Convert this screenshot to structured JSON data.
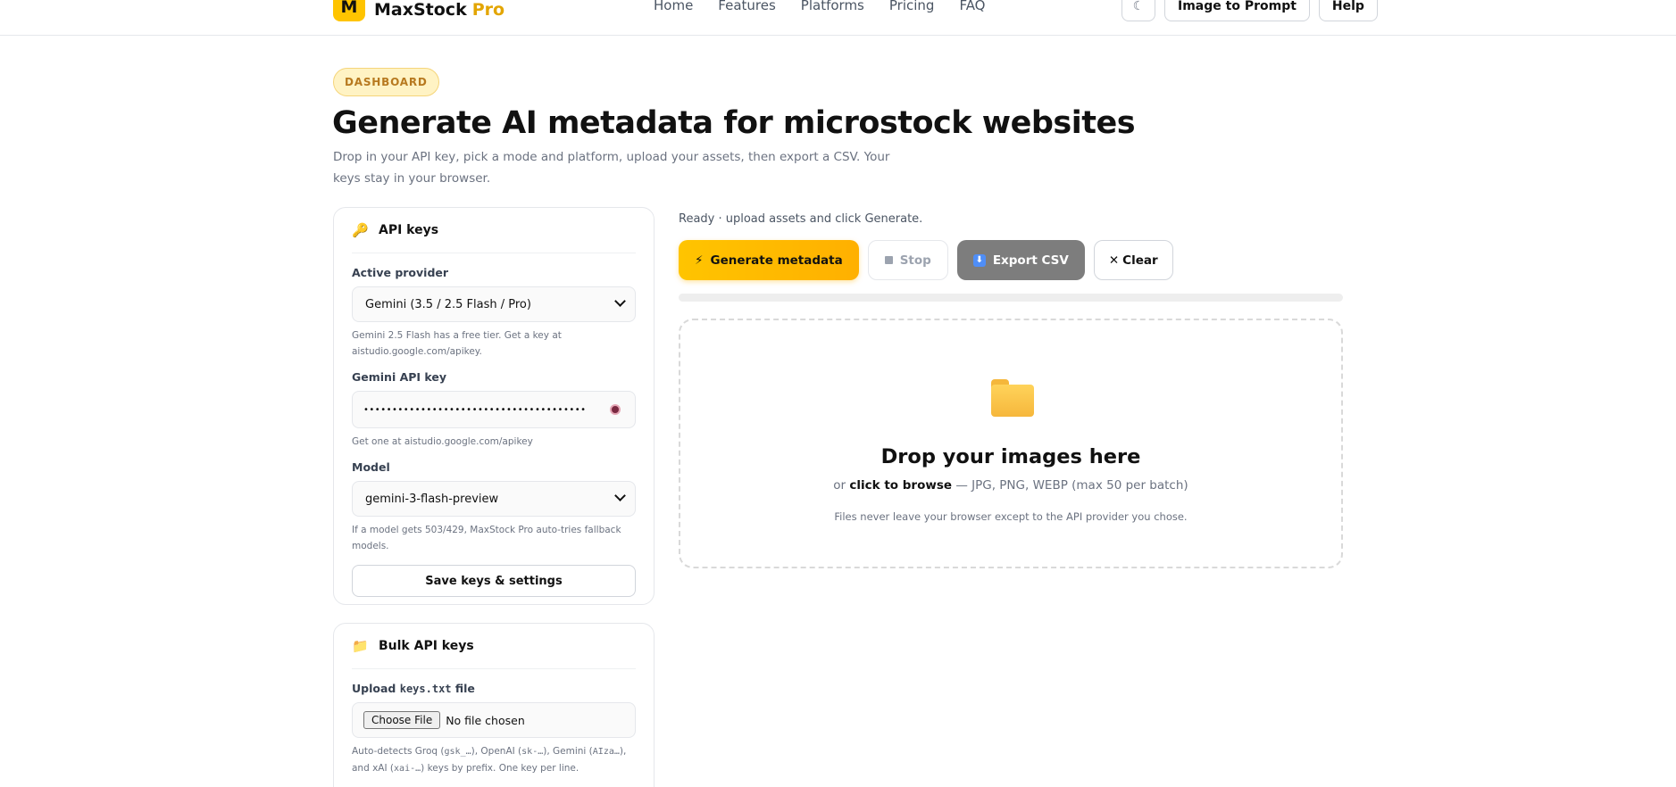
{
  "header": {
    "logo_letter": "M",
    "brand": "MaxStock",
    "brand_suffix": "Pro",
    "nav": [
      "Home",
      "Features",
      "Platforms",
      "Pricing",
      "FAQ"
    ],
    "theme_icon": "☾",
    "image_to_prompt": "Image to Prompt",
    "help": "Help"
  },
  "hero": {
    "badge": "DASHBOARD",
    "title": "Generate AI metadata for microstock websites",
    "subtitle": "Drop in your API key, pick a mode and platform, upload your assets, then export a CSV. Your keys stay in your browser."
  },
  "api_card": {
    "icon": "🔑",
    "title": "API keys",
    "provider_label": "Active provider",
    "provider_value": "Gemini (3.5 / 2.5 Flash / Pro)",
    "provider_hint": "Gemini 2.5 Flash has a free tier. Get a key at aistudio.google.com/apikey.",
    "key_label": "Gemini API key",
    "key_value": "•••••••••••••••••••••••••••••••••••••••",
    "key_hint": "Get one at aistudio.google.com/apikey",
    "model_label": "Model",
    "model_value": "gemini-3-flash-preview",
    "model_hint": "If a model gets 503/429, MaxStock Pro auto-tries fallback models.",
    "save_label": "Save keys & settings"
  },
  "bulk_card": {
    "icon": "📁",
    "title": "Bulk API keys",
    "upload_label_pre": "Upload",
    "upload_label_code": "keys.txt",
    "upload_label_post": "file",
    "choose_file": "Choose File",
    "no_file": "No file chosen",
    "hint_parts": [
      "Auto-detects Groq (",
      "gsk_…",
      "), OpenAI (",
      "sk-…",
      "), Gemini (",
      "AIza…",
      "), and xAI (",
      "xai-…",
      ") keys by prefix. One key per line."
    ]
  },
  "workspace": {
    "status": "Ready · upload assets and click Generate.",
    "generate_icon": "⚡",
    "generate": "Generate metadata",
    "stop": "Stop",
    "export_icon": "⬇",
    "export": "Export CSV",
    "clear_icon": "✕",
    "clear": "Clear",
    "progress": 0,
    "drop_title": "Drop your images here",
    "drop_sub_pre": "or",
    "drop_sub_link": "click to browse",
    "drop_sub_post": "— JPG, PNG, WEBP (max 50 per batch)",
    "drop_note": "Files never leave your browser except to the API provider you chose."
  }
}
